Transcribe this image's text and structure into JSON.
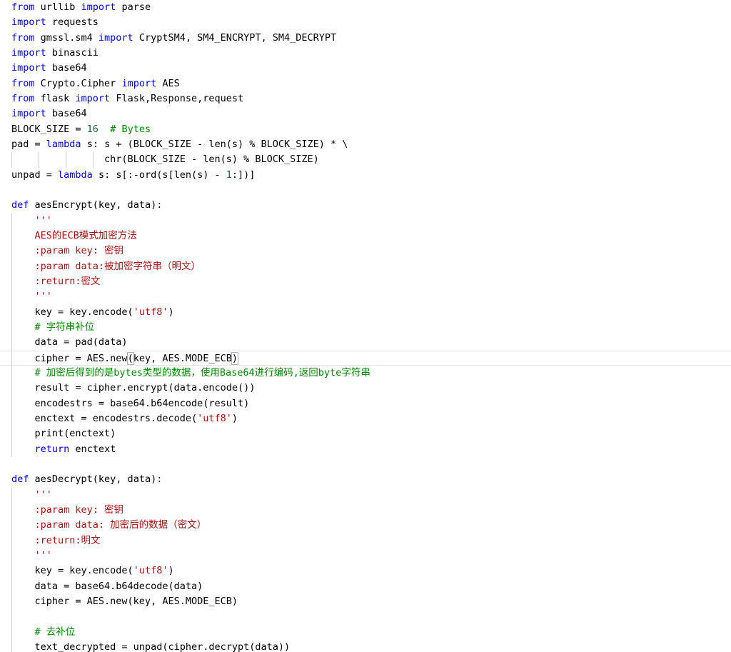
{
  "colors": {
    "keyword": "#0000ff",
    "string": "#aa1111",
    "number": "#116644",
    "comment": "#008800",
    "text": "#000000",
    "background": "#ffffff"
  },
  "code": {
    "active_line": 23,
    "lines": [
      [
        {
          "t": "kw",
          "v": "from"
        },
        {
          "t": "",
          "v": " urllib "
        },
        {
          "t": "kw",
          "v": "import"
        },
        {
          "t": "",
          "v": " parse"
        }
      ],
      [
        {
          "t": "kw",
          "v": "import"
        },
        {
          "t": "",
          "v": " requests"
        }
      ],
      [
        {
          "t": "kw",
          "v": "from"
        },
        {
          "t": "",
          "v": " gmssl.sm4 "
        },
        {
          "t": "kw",
          "v": "import"
        },
        {
          "t": "",
          "v": " CryptSM4, SM4_ENCRYPT, SM4_DECRYPT"
        }
      ],
      [
        {
          "t": "kw",
          "v": "import"
        },
        {
          "t": "",
          "v": " binascii"
        }
      ],
      [
        {
          "t": "kw",
          "v": "import"
        },
        {
          "t": "",
          "v": " base64"
        }
      ],
      [
        {
          "t": "kw",
          "v": "from"
        },
        {
          "t": "",
          "v": " Crypto.Cipher "
        },
        {
          "t": "kw",
          "v": "import"
        },
        {
          "t": "",
          "v": " AES"
        }
      ],
      [
        {
          "t": "kw",
          "v": "from"
        },
        {
          "t": "",
          "v": " flask "
        },
        {
          "t": "kw",
          "v": "import"
        },
        {
          "t": "",
          "v": " Flask,Response,request"
        }
      ],
      [
        {
          "t": "kw",
          "v": "import"
        },
        {
          "t": "",
          "v": " base64"
        }
      ],
      [
        {
          "t": "",
          "v": "BLOCK_SIZE = "
        },
        {
          "t": "num",
          "v": "16"
        },
        {
          "t": "",
          "v": "  "
        },
        {
          "t": "com",
          "v": "# Bytes"
        }
      ],
      [
        {
          "t": "",
          "v": "pad = "
        },
        {
          "t": "kw",
          "v": "lambda"
        },
        {
          "t": "",
          "v": " s: s + (BLOCK_SIZE - len(s) % BLOCK_SIZE) * \\"
        }
      ],
      [
        {
          "t": "",
          "v": "                chr(BLOCK_SIZE - len(s) % BLOCK_SIZE)"
        }
      ],
      [
        {
          "t": "",
          "v": "unpad = "
        },
        {
          "t": "kw",
          "v": "lambda"
        },
        {
          "t": "",
          "v": " s: s[:-ord(s[len(s) - "
        },
        {
          "t": "num",
          "v": "1"
        },
        {
          "t": "",
          "v": ":])]"
        }
      ],
      [],
      [
        {
          "t": "kw",
          "v": "def"
        },
        {
          "t": "",
          "v": " aesEncrypt(key, data):"
        }
      ],
      [
        {
          "t": "",
          "v": "    "
        },
        {
          "t": "doc",
          "v": "'''"
        }
      ],
      [
        {
          "t": "",
          "v": "    "
        },
        {
          "t": "doc",
          "v": "AES的ECB模式加密方法"
        }
      ],
      [
        {
          "t": "",
          "v": "    "
        },
        {
          "t": "doc",
          "v": ":param key: 密钥"
        }
      ],
      [
        {
          "t": "",
          "v": "    "
        },
        {
          "t": "doc",
          "v": ":param data:被加密字符串（明文）"
        }
      ],
      [
        {
          "t": "",
          "v": "    "
        },
        {
          "t": "doc",
          "v": ":return:密文"
        }
      ],
      [
        {
          "t": "",
          "v": "    "
        },
        {
          "t": "doc",
          "v": "'''"
        }
      ],
      [
        {
          "t": "",
          "v": "    key = key.encode("
        },
        {
          "t": "str",
          "v": "'utf8'"
        },
        {
          "t": "",
          "v": ")"
        }
      ],
      [
        {
          "t": "",
          "v": "    "
        },
        {
          "t": "com",
          "v": "# 字符串补位"
        }
      ],
      [
        {
          "t": "",
          "v": "    data = pad(data)"
        }
      ],
      [
        {
          "t": "",
          "v": "    cipher = AES.new"
        },
        {
          "t": "bracket",
          "v": "("
        },
        {
          "t": "",
          "v": "key, AES.MODE_ECB"
        },
        {
          "t": "bracket",
          "v": ")"
        }
      ],
      [
        {
          "t": "",
          "v": "    "
        },
        {
          "t": "com",
          "v": "# 加密后得到的是bytes类型的数据，使用Base64进行编码,返回byte字符串"
        }
      ],
      [
        {
          "t": "",
          "v": "    result = cipher.encrypt(data.encode())"
        }
      ],
      [
        {
          "t": "",
          "v": "    encodestrs = base64.b64encode(result)"
        }
      ],
      [
        {
          "t": "",
          "v": "    enctext = encodestrs.decode("
        },
        {
          "t": "str",
          "v": "'utf8'"
        },
        {
          "t": "",
          "v": ")"
        }
      ],
      [
        {
          "t": "",
          "v": "    print(enctext)"
        }
      ],
      [
        {
          "t": "",
          "v": "    "
        },
        {
          "t": "kw",
          "v": "return"
        },
        {
          "t": "",
          "v": " enctext"
        }
      ],
      [],
      [
        {
          "t": "kw",
          "v": "def"
        },
        {
          "t": "",
          "v": " aesDecrypt(key, data):"
        }
      ],
      [
        {
          "t": "",
          "v": "    "
        },
        {
          "t": "doc",
          "v": "'''"
        }
      ],
      [
        {
          "t": "",
          "v": "    "
        },
        {
          "t": "doc",
          "v": ":param key: 密钥"
        }
      ],
      [
        {
          "t": "",
          "v": "    "
        },
        {
          "t": "doc",
          "v": ":param data: 加密后的数据（密文）"
        }
      ],
      [
        {
          "t": "",
          "v": "    "
        },
        {
          "t": "doc",
          "v": ":return:明文"
        }
      ],
      [
        {
          "t": "",
          "v": "    "
        },
        {
          "t": "doc",
          "v": "'''"
        }
      ],
      [
        {
          "t": "",
          "v": "    key = key.encode("
        },
        {
          "t": "str",
          "v": "'utf8'"
        },
        {
          "t": "",
          "v": ")"
        }
      ],
      [
        {
          "t": "",
          "v": "    data = base64.b64decode(data)"
        }
      ],
      [
        {
          "t": "",
          "v": "    cipher = AES.new(key, AES.MODE_ECB)"
        }
      ],
      [],
      [
        {
          "t": "",
          "v": "    "
        },
        {
          "t": "com",
          "v": "# 去补位"
        }
      ],
      [
        {
          "t": "",
          "v": "    text_decrypted = unpad(cipher.decrypt(data))"
        }
      ]
    ]
  }
}
